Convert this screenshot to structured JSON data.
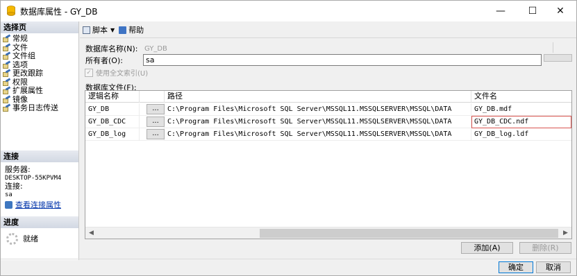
{
  "window": {
    "title": "数据库属性 - GY_DB",
    "minimize": "—",
    "maximize": "☐",
    "close": "✕"
  },
  "left": {
    "select_page_header": "选择页",
    "pages": [
      "常规",
      "文件",
      "文件组",
      "选项",
      "更改跟踪",
      "权限",
      "扩展属性",
      "镜像",
      "事务日志传送"
    ],
    "connection_header": "连接",
    "server_label": "服务器:",
    "server_value": "DESKTOP-55KPVM4",
    "connection_label": "连接:",
    "connection_value": "sa",
    "view_connection_link": "查看连接属性",
    "progress_header": "进度",
    "progress_status": "就绪"
  },
  "toolbar": {
    "script_label": "脚本",
    "help_label": "帮助"
  },
  "form": {
    "dbname_label": "数据库名称(N):",
    "dbname_value": "GY_DB",
    "owner_label": "所有者(O):",
    "owner_value": "sa",
    "fulltext_label": "使用全文索引(U)",
    "files_label": "数据库文件(F):"
  },
  "grid": {
    "headers": [
      "逻辑名称",
      "",
      "路径",
      "文件名"
    ],
    "ellipsis": "...",
    "rows": [
      {
        "name": "GY_DB",
        "path": "C:\\Program Files\\Microsoft SQL Server\\MSSQL11.MSSQLSERVER\\MSSQL\\DATA",
        "file": "GY_DB.mdf"
      },
      {
        "name": "GY_DB_CDC",
        "path": "C:\\Program Files\\Microsoft SQL Server\\MSSQL11.MSSQLSERVER\\MSSQL\\DATA",
        "file": "GY_DB_CDC.ndf"
      },
      {
        "name": "GY_DB_log",
        "path": "C:\\Program Files\\Microsoft SQL Server\\MSSQL11.MSSQLSERVER\\MSSQL\\DATA",
        "file": "GY_DB_log.ldf"
      }
    ]
  },
  "buttons": {
    "add": "添加(A)",
    "remove": "删除(R)",
    "ok": "确定",
    "cancel": "取消"
  },
  "colors": {
    "highlight_border": "#d9534f",
    "link": "#0033aa",
    "default_button_border": "#0078d7"
  }
}
